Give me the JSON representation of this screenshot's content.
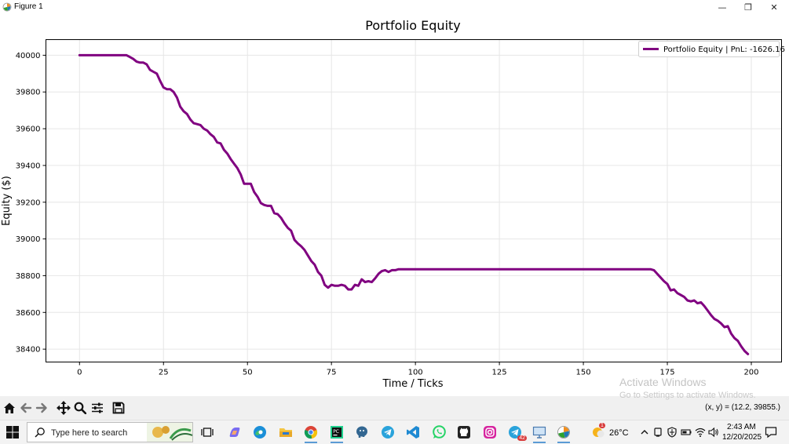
{
  "window": {
    "title": "Figure 1",
    "minimize": "—",
    "restore": "❐",
    "close": "✕"
  },
  "chart_data": {
    "type": "line",
    "title": "Portfolio Equity",
    "xlabel": "Time / Ticks",
    "ylabel": "Equity ($)",
    "xlim": [
      -10,
      209
    ],
    "ylim": [
      38330,
      40085
    ],
    "xticks": [
      0,
      25,
      50,
      75,
      100,
      125,
      150,
      175,
      200
    ],
    "yticks": [
      38400,
      38600,
      38800,
      39000,
      39200,
      39400,
      39600,
      39800,
      40000
    ],
    "grid": true,
    "legend": "top-right",
    "series": [
      {
        "name": "Portfolio Equity | PnL: -1626.16",
        "color": "#800080",
        "points": [
          [
            0,
            40000
          ],
          [
            14,
            40000
          ],
          [
            15,
            39990
          ],
          [
            16,
            39980
          ],
          [
            17,
            39965
          ],
          [
            18,
            39960
          ],
          [
            19,
            39960
          ],
          [
            20,
            39950
          ],
          [
            21,
            39920
          ],
          [
            22,
            39910
          ],
          [
            23,
            39900
          ],
          [
            24,
            39860
          ],
          [
            25,
            39825
          ],
          [
            26,
            39815
          ],
          [
            27,
            39815
          ],
          [
            28,
            39800
          ],
          [
            29,
            39770
          ],
          [
            30,
            39720
          ],
          [
            31,
            39695
          ],
          [
            32,
            39680
          ],
          [
            33,
            39650
          ],
          [
            34,
            39630
          ],
          [
            35,
            39625
          ],
          [
            36,
            39620
          ],
          [
            37,
            39600
          ],
          [
            38,
            39590
          ],
          [
            39,
            39570
          ],
          [
            40,
            39555
          ],
          [
            41,
            39525
          ],
          [
            42,
            39520
          ],
          [
            43,
            39485
          ],
          [
            44,
            39465
          ],
          [
            45,
            39435
          ],
          [
            46,
            39410
          ],
          [
            47,
            39385
          ],
          [
            48,
            39350
          ],
          [
            49,
            39300
          ],
          [
            50,
            39300
          ],
          [
            51,
            39300
          ],
          [
            52,
            39255
          ],
          [
            53,
            39230
          ],
          [
            54,
            39195
          ],
          [
            55,
            39185
          ],
          [
            56,
            39180
          ],
          [
            57,
            39180
          ],
          [
            58,
            39140
          ],
          [
            59,
            39135
          ],
          [
            60,
            39115
          ],
          [
            61,
            39085
          ],
          [
            62,
            39060
          ],
          [
            63,
            39045
          ],
          [
            64,
            38995
          ],
          [
            65,
            38975
          ],
          [
            66,
            38960
          ],
          [
            67,
            38940
          ],
          [
            68,
            38910
          ],
          [
            69,
            38880
          ],
          [
            70,
            38860
          ],
          [
            71,
            38820
          ],
          [
            72,
            38800
          ],
          [
            73,
            38750
          ],
          [
            74,
            38735
          ],
          [
            75,
            38750
          ],
          [
            76,
            38745
          ],
          [
            77,
            38745
          ],
          [
            78,
            38750
          ],
          [
            79,
            38745
          ],
          [
            80,
            38725
          ],
          [
            81,
            38725
          ],
          [
            82,
            38750
          ],
          [
            83,
            38745
          ],
          [
            84,
            38780
          ],
          [
            85,
            38765
          ],
          [
            86,
            38770
          ],
          [
            87,
            38765
          ],
          [
            88,
            38785
          ],
          [
            89,
            38810
          ],
          [
            90,
            38825
          ],
          [
            91,
            38830
          ],
          [
            92,
            38820
          ],
          [
            93,
            38830
          ],
          [
            94,
            38830
          ],
          [
            95,
            38835
          ],
          [
            170,
            38835
          ],
          [
            171,
            38830
          ],
          [
            172,
            38810
          ],
          [
            173,
            38790
          ],
          [
            174,
            38770
          ],
          [
            175,
            38755
          ],
          [
            176,
            38720
          ],
          [
            177,
            38725
          ],
          [
            178,
            38705
          ],
          [
            179,
            38695
          ],
          [
            180,
            38685
          ],
          [
            181,
            38665
          ],
          [
            182,
            38660
          ],
          [
            183,
            38665
          ],
          [
            184,
            38650
          ],
          [
            185,
            38655
          ],
          [
            186,
            38635
          ],
          [
            187,
            38610
          ],
          [
            188,
            38585
          ],
          [
            189,
            38565
          ],
          [
            190,
            38555
          ],
          [
            191,
            38540
          ],
          [
            192,
            38520
          ],
          [
            193,
            38525
          ],
          [
            194,
            38485
          ],
          [
            195,
            38460
          ],
          [
            196,
            38445
          ],
          [
            197,
            38415
          ],
          [
            198,
            38390
          ],
          [
            199,
            38373
          ]
        ]
      }
    ]
  },
  "toolbar": {
    "coords": "(x, y) = (12.2, 39855.)",
    "icons": [
      "home-icon",
      "back-icon",
      "forward-icon",
      "pan-icon",
      "zoom-icon",
      "configure-subplots-icon",
      "save-icon"
    ]
  },
  "watermark": {
    "line1": "Activate Windows",
    "line2": "Go to Settings to activate Windows."
  },
  "taskbar": {
    "search_placeholder": "Type here to search",
    "weather": "26°C",
    "time": "2:43 AM",
    "date": "12/20/2025",
    "badge_weather": "1",
    "badge_telegram": "42"
  },
  "colors": {
    "line": "#800080",
    "grid": "#e6e6e6",
    "toolbar_bg": "#f0f0f0",
    "taskbar_bg": "#f3f3f3",
    "accent": "#0078d4"
  }
}
